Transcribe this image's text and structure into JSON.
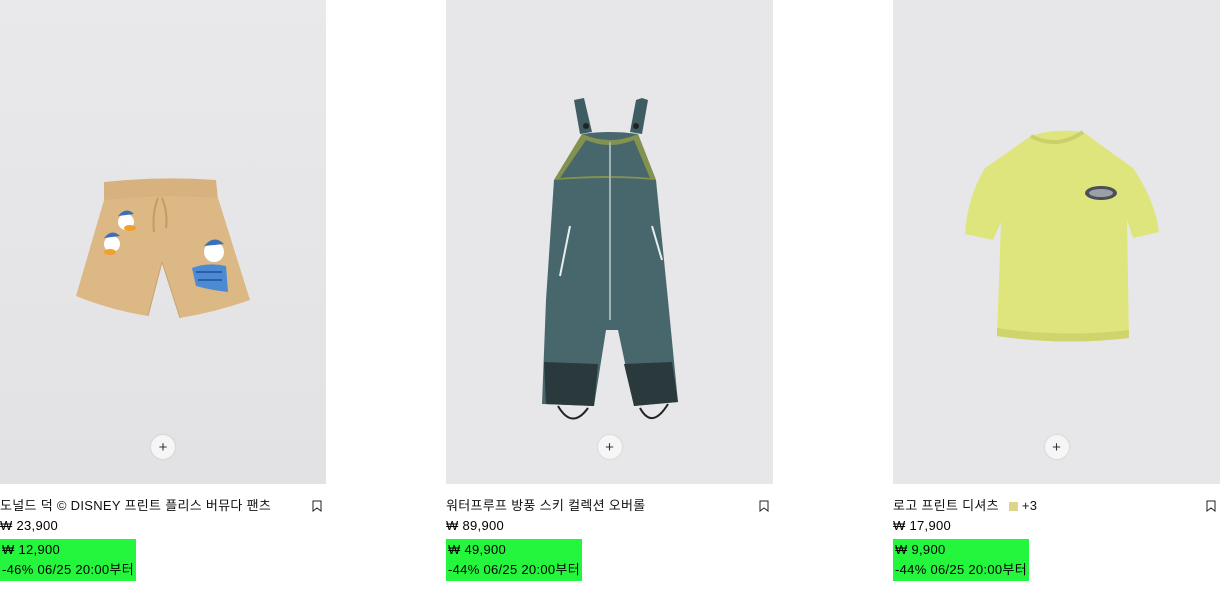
{
  "products": [
    {
      "title": "도널드 덕 © DISNEY 프린트 플리스 버뮤다 팬츠",
      "price": "₩ 23,900",
      "sale_price": "₩ 12,900",
      "discount": "-46% 06/25 20:00부터",
      "quick_add": "+",
      "image_icon": "bermuda-shorts-image"
    },
    {
      "title": "워터프루프 방풍 스키 컬렉션 오버롤",
      "price": "₩ 89,900",
      "sale_price": "₩ 49,900",
      "discount": "-44% 06/25 20:00부터",
      "quick_add": "+",
      "image_icon": "ski-overalls-image"
    },
    {
      "title": "로고 프린트 디셔츠",
      "more_colors": "+3",
      "swatch_color": "#ddd58a",
      "price": "₩ 17,900",
      "sale_price": "₩ 9,900",
      "discount": "-44% 06/25 20:00부터",
      "quick_add": "+",
      "image_icon": "tshirt-image"
    }
  ],
  "colors": {
    "sale_highlight": "#24f53d",
    "image_background": "#e8e8ea"
  }
}
